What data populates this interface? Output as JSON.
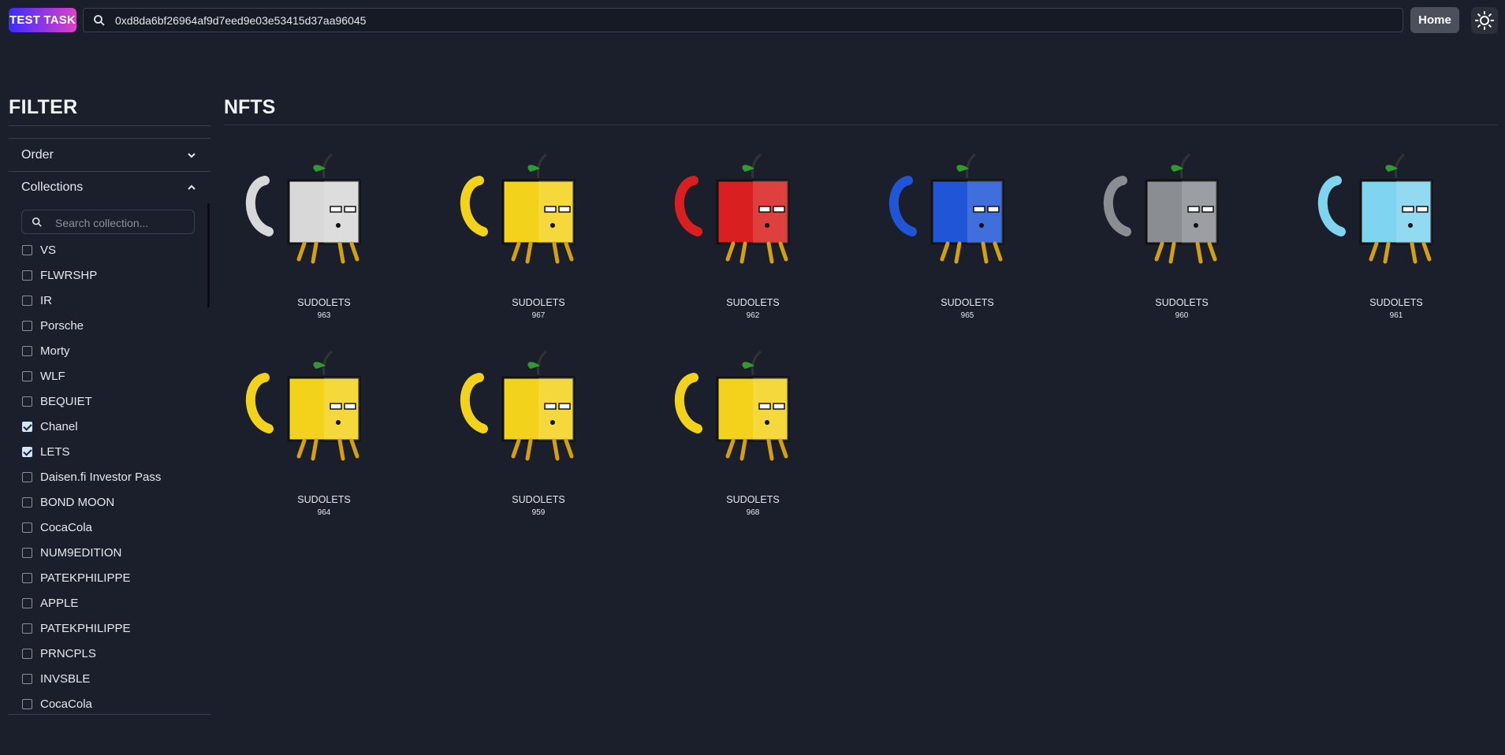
{
  "header": {
    "brand": "TEST TASK",
    "search_value": "0xd8da6bf26964af9d7eed9e03e53415d37aa96045",
    "home_label": "Home",
    "theme_icon": "sun-icon"
  },
  "sidebar": {
    "title": "FILTER",
    "order_label": "Order",
    "collections_label": "Collections",
    "search_placeholder": "Search collection...",
    "items": [
      {
        "label": "VS",
        "checked": false
      },
      {
        "label": "FLWRSHP",
        "checked": false
      },
      {
        "label": "IR",
        "checked": false
      },
      {
        "label": "Porsche",
        "checked": false
      },
      {
        "label": "Morty",
        "checked": false
      },
      {
        "label": "WLF",
        "checked": false
      },
      {
        "label": "BEQUIET",
        "checked": false
      },
      {
        "label": "Chanel",
        "checked": true
      },
      {
        "label": "LETS",
        "checked": true
      },
      {
        "label": "Daisen.fi Investor Pass",
        "checked": false
      },
      {
        "label": "BOND MOON",
        "checked": false
      },
      {
        "label": "CocaCola",
        "checked": false
      },
      {
        "label": "NUM9EDITION",
        "checked": false
      },
      {
        "label": "PATEKPHILIPPE",
        "checked": false
      },
      {
        "label": "APPLE",
        "checked": false
      },
      {
        "label": "PATEKPHILIPPE",
        "checked": false
      },
      {
        "label": "PRNCPLS",
        "checked": false
      },
      {
        "label": "INVSBLE",
        "checked": false
      },
      {
        "label": "CocaCola",
        "checked": false
      }
    ]
  },
  "main": {
    "title": "NFTS",
    "nfts": [
      {
        "collection": "SUDOLETS",
        "number": "963",
        "color": "#d8d8d8"
      },
      {
        "collection": "SUDOLETS",
        "number": "967",
        "color": "#f2d21a"
      },
      {
        "collection": "SUDOLETS",
        "number": "962",
        "color": "#d91f1f"
      },
      {
        "collection": "SUDOLETS",
        "number": "965",
        "color": "#1f55d6"
      },
      {
        "collection": "SUDOLETS",
        "number": "960",
        "color": "#8a8d92"
      },
      {
        "collection": "SUDOLETS",
        "number": "961",
        "color": "#7fd4ef"
      },
      {
        "collection": "SUDOLETS",
        "number": "964",
        "color": "#f2d21a"
      },
      {
        "collection": "SUDOLETS",
        "number": "959",
        "color": "#f2d21a"
      },
      {
        "collection": "SUDOLETS",
        "number": "968",
        "color": "#f2d21a"
      }
    ]
  }
}
